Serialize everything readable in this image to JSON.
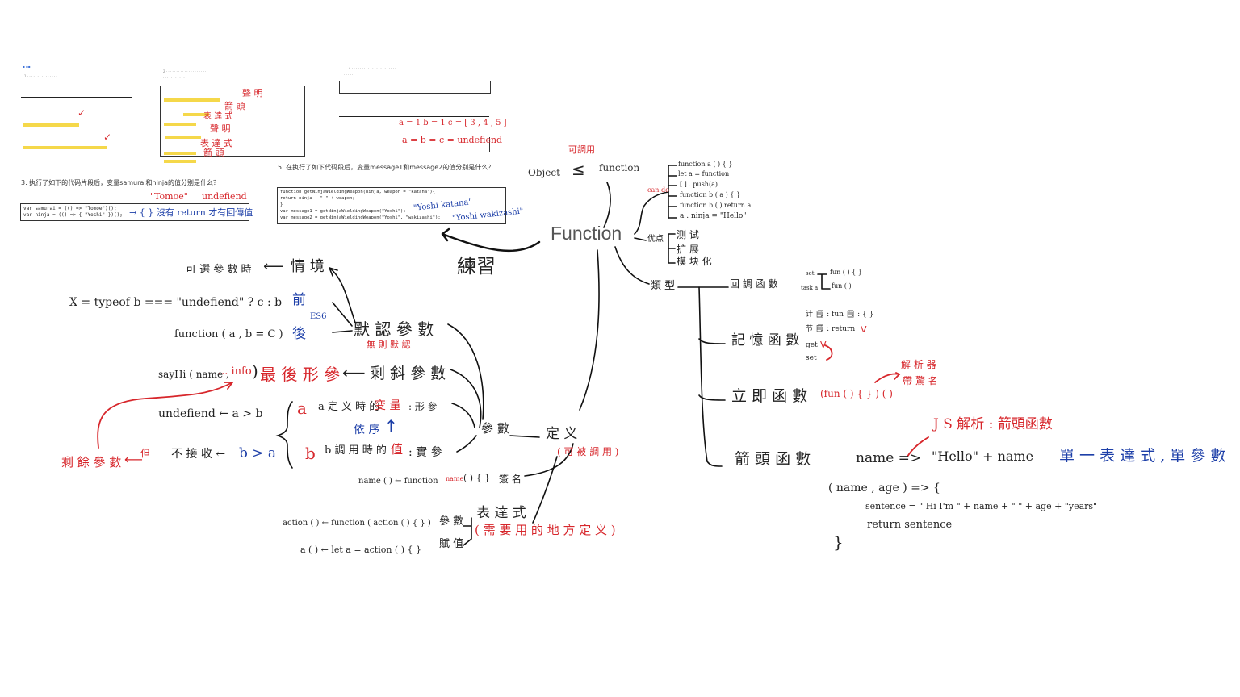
{
  "central": "Function",
  "practice": "練習",
  "top": {
    "object": "Object",
    "leq": "≤",
    "function": "function",
    "callable": "可調用"
  },
  "can_do": {
    "label": "can do",
    "items": [
      "function  a  ( ) { }",
      "let  a  =  function",
      "[ ] . push(a)",
      "function  b  ( a ) { }",
      "function  b ( )  return  a",
      "a . ninja  =  \"Hello\""
    ]
  },
  "advantages": {
    "label": "优点",
    "items": [
      "测 试",
      "扩 展",
      "模 块 化"
    ]
  },
  "types": {
    "label": "類 型",
    "callback": "回 調 函 數",
    "callback_set": "set",
    "callback_task": "task a",
    "callback_fn1": "fun ( ) { }",
    "callback_fn2": "fun ( )"
  },
  "memo": {
    "label": "記 憶 函 數",
    "l1": "计 🗒 : fun 🗒 : { }",
    "l2": "节 🗒 : return",
    "l3": "get",
    "l4": "set",
    "check1": "V",
    "check2": "V"
  },
  "iife": {
    "label": "立 即 函 數",
    "code": "(fun ( ) { } ) ( )",
    "note1": "解 析 器",
    "note2": "帶 驚 名"
  },
  "arrow": {
    "label": "箭 頭 函 數",
    "js_parse": "J S 解析 : 箭頭函數",
    "expr": "name  =>",
    "hello": "\"Hello\"  +  name",
    "single": "單 一 表 達 式 , 單 參 數",
    "code1": "( name ,  age )  =>   {",
    "code2": "sentence  =  \" Hi  I'm \"  +  name  +  \"  \"  +  age  +  \"years\"",
    "code3": "return  sentence",
    "code4": "}"
  },
  "definition": {
    "label": "定 义",
    "note": "( 可 被 調 用 )"
  },
  "params": {
    "label": "參 數",
    "a_line": "a   定 义 時 的",
    "a_var": "变 量",
    "a_end": ": 形 參",
    "order": "依 序",
    "b_line": "b   調 用 時 的",
    "b_val": "值",
    "b_end": ": 實 參",
    "undef_cmp": "undefiend  ←  a  >  b",
    "noreceive": "不 接 收  ←",
    "ba": "b  >  a",
    "but": "但",
    "rest_params": "剩 餘 參 數"
  },
  "rest": {
    "label": "剩 斜 參 數",
    "sayhi": "sayHi ( name ,",
    "info": "... info",
    "last": "最 後 形 參"
  },
  "default": {
    "label": "默 認 參 數",
    "no_default": "無 則 默 認",
    "es6": "ES6",
    "ternary": "X  =  typeof  b   ===  \"undefiend\"  ?   c   :   b",
    "before": "前",
    "fn": "function (   a  ,  b = C )",
    "after": "後",
    "optional": "可 選 參 數 時",
    "scenario": "情 境"
  },
  "naming": {
    "code": "name ( )  ←   function",
    "name": "name",
    "rest": "( ) { }",
    "label": "簽 名"
  },
  "expression": {
    "label": "表 達 式",
    "note": "( 需 要 用 的 地 方 定 义 )",
    "r1": "action ( )   ←     function ( action  ( ) { } )",
    "r1_label": "參 數",
    "r2": "a ( )   ←   let  a  =      action ( ) { }",
    "r2_label": "賦 值"
  },
  "exercises": {
    "q2_labels": [
      "聲 明",
      "箭 頭",
      "表 達 式",
      "聲 明",
      "表 達 式",
      "箭 頭"
    ],
    "q3_title": "3.  执行了如下的代码片段后，变量samurai和ninja的值分别是什么？",
    "q3_code1": "var samurai = (() => \"Tomoe\")();",
    "q3_code2": "var ninja = (() => { \"Yoshi\" })();",
    "q3_ans1": "\"Tomoe\"",
    "q3_ans2": "undefiend",
    "q3_note": "→ { } 沒有 return 才有回傳值",
    "q4_ans1": "a = 1   b = 1   c = [ 3 , 4 , 5 ]",
    "q4_ans2": "a = b = c = undefiend",
    "q5_title": "5.  在执行了如下代码段后，变量message1和message2的值分别是什么？",
    "q5_code": [
      "function getNinjaWieldingWeapon(ninja, weapon = \"katana\"){",
      "  return ninja + \" \" + weapon;",
      "}",
      "var message1 = getNinjaWieldingWeapon(\"Yoshi\");",
      "var message2 = getNinjaWieldingWeapon(\"Yoshi\", \"wakizashi\");"
    ],
    "q5_ans1": "\"Yoshi  katana\"",
    "q5_ans2": "\"Yoshi  wakizashi\""
  },
  "colors": {
    "red": "#d7262b",
    "blue": "#1d3fa8",
    "ink": "#222222",
    "highlight": "#f5d84a"
  }
}
